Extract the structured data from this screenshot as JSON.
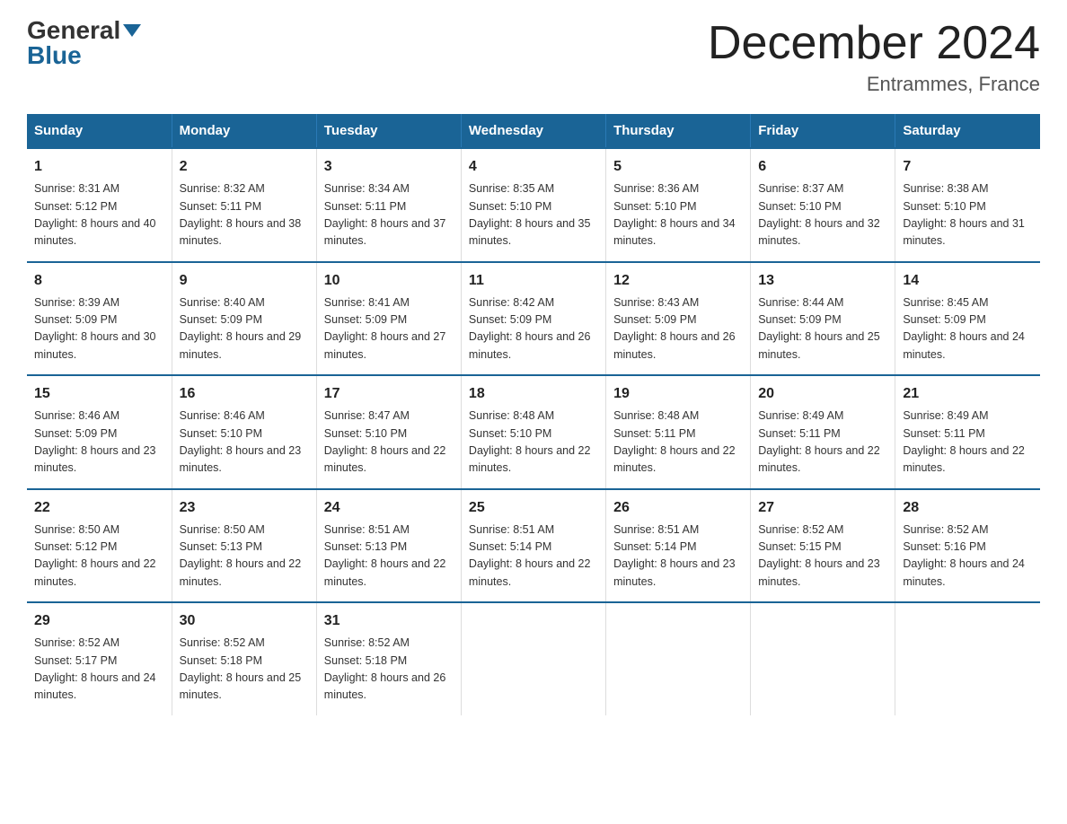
{
  "logo": {
    "general": "General",
    "blue": "Blue"
  },
  "title": "December 2024",
  "location": "Entrammes, France",
  "days_of_week": [
    "Sunday",
    "Monday",
    "Tuesday",
    "Wednesday",
    "Thursday",
    "Friday",
    "Saturday"
  ],
  "weeks": [
    [
      {
        "day": "1",
        "sunrise": "8:31 AM",
        "sunset": "5:12 PM",
        "daylight": "8 hours and 40 minutes."
      },
      {
        "day": "2",
        "sunrise": "8:32 AM",
        "sunset": "5:11 PM",
        "daylight": "8 hours and 38 minutes."
      },
      {
        "day": "3",
        "sunrise": "8:34 AM",
        "sunset": "5:11 PM",
        "daylight": "8 hours and 37 minutes."
      },
      {
        "day": "4",
        "sunrise": "8:35 AM",
        "sunset": "5:10 PM",
        "daylight": "8 hours and 35 minutes."
      },
      {
        "day": "5",
        "sunrise": "8:36 AM",
        "sunset": "5:10 PM",
        "daylight": "8 hours and 34 minutes."
      },
      {
        "day": "6",
        "sunrise": "8:37 AM",
        "sunset": "5:10 PM",
        "daylight": "8 hours and 32 minutes."
      },
      {
        "day": "7",
        "sunrise": "8:38 AM",
        "sunset": "5:10 PM",
        "daylight": "8 hours and 31 minutes."
      }
    ],
    [
      {
        "day": "8",
        "sunrise": "8:39 AM",
        "sunset": "5:09 PM",
        "daylight": "8 hours and 30 minutes."
      },
      {
        "day": "9",
        "sunrise": "8:40 AM",
        "sunset": "5:09 PM",
        "daylight": "8 hours and 29 minutes."
      },
      {
        "day": "10",
        "sunrise": "8:41 AM",
        "sunset": "5:09 PM",
        "daylight": "8 hours and 27 minutes."
      },
      {
        "day": "11",
        "sunrise": "8:42 AM",
        "sunset": "5:09 PM",
        "daylight": "8 hours and 26 minutes."
      },
      {
        "day": "12",
        "sunrise": "8:43 AM",
        "sunset": "5:09 PM",
        "daylight": "8 hours and 26 minutes."
      },
      {
        "day": "13",
        "sunrise": "8:44 AM",
        "sunset": "5:09 PM",
        "daylight": "8 hours and 25 minutes."
      },
      {
        "day": "14",
        "sunrise": "8:45 AM",
        "sunset": "5:09 PM",
        "daylight": "8 hours and 24 minutes."
      }
    ],
    [
      {
        "day": "15",
        "sunrise": "8:46 AM",
        "sunset": "5:09 PM",
        "daylight": "8 hours and 23 minutes."
      },
      {
        "day": "16",
        "sunrise": "8:46 AM",
        "sunset": "5:10 PM",
        "daylight": "8 hours and 23 minutes."
      },
      {
        "day": "17",
        "sunrise": "8:47 AM",
        "sunset": "5:10 PM",
        "daylight": "8 hours and 22 minutes."
      },
      {
        "day": "18",
        "sunrise": "8:48 AM",
        "sunset": "5:10 PM",
        "daylight": "8 hours and 22 minutes."
      },
      {
        "day": "19",
        "sunrise": "8:48 AM",
        "sunset": "5:11 PM",
        "daylight": "8 hours and 22 minutes."
      },
      {
        "day": "20",
        "sunrise": "8:49 AM",
        "sunset": "5:11 PM",
        "daylight": "8 hours and 22 minutes."
      },
      {
        "day": "21",
        "sunrise": "8:49 AM",
        "sunset": "5:11 PM",
        "daylight": "8 hours and 22 minutes."
      }
    ],
    [
      {
        "day": "22",
        "sunrise": "8:50 AM",
        "sunset": "5:12 PM",
        "daylight": "8 hours and 22 minutes."
      },
      {
        "day": "23",
        "sunrise": "8:50 AM",
        "sunset": "5:13 PM",
        "daylight": "8 hours and 22 minutes."
      },
      {
        "day": "24",
        "sunrise": "8:51 AM",
        "sunset": "5:13 PM",
        "daylight": "8 hours and 22 minutes."
      },
      {
        "day": "25",
        "sunrise": "8:51 AM",
        "sunset": "5:14 PM",
        "daylight": "8 hours and 22 minutes."
      },
      {
        "day": "26",
        "sunrise": "8:51 AM",
        "sunset": "5:14 PM",
        "daylight": "8 hours and 23 minutes."
      },
      {
        "day": "27",
        "sunrise": "8:52 AM",
        "sunset": "5:15 PM",
        "daylight": "8 hours and 23 minutes."
      },
      {
        "day": "28",
        "sunrise": "8:52 AM",
        "sunset": "5:16 PM",
        "daylight": "8 hours and 24 minutes."
      }
    ],
    [
      {
        "day": "29",
        "sunrise": "8:52 AM",
        "sunset": "5:17 PM",
        "daylight": "8 hours and 24 minutes."
      },
      {
        "day": "30",
        "sunrise": "8:52 AM",
        "sunset": "5:18 PM",
        "daylight": "8 hours and 25 minutes."
      },
      {
        "day": "31",
        "sunrise": "8:52 AM",
        "sunset": "5:18 PM",
        "daylight": "8 hours and 26 minutes."
      },
      null,
      null,
      null,
      null
    ]
  ],
  "labels": {
    "sunrise": "Sunrise:",
    "sunset": "Sunset:",
    "daylight": "Daylight:"
  }
}
